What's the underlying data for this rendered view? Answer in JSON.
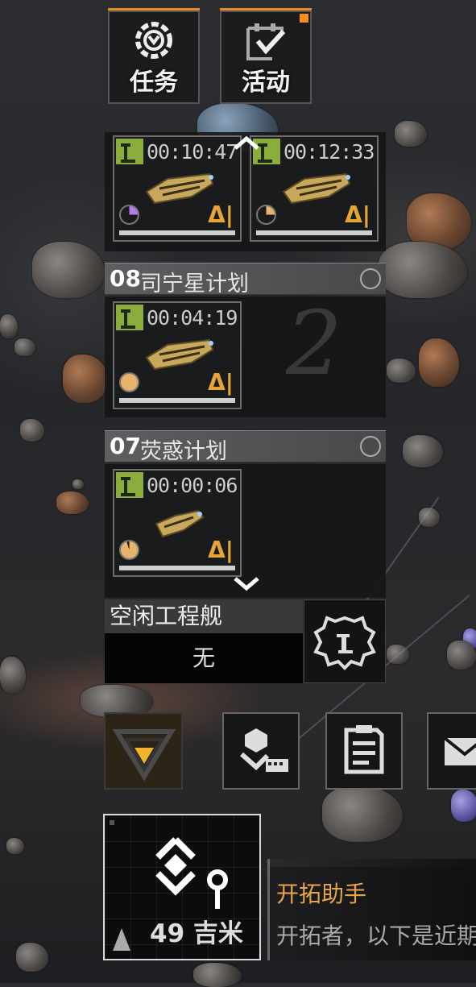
{
  "top_buttons": [
    {
      "label": "任务",
      "icon": "mission-gear-icon"
    },
    {
      "label": "活动",
      "icon": "activity-check-icon",
      "badge": true
    }
  ],
  "queue": {
    "cards": [
      {
        "time": "00:10:47",
        "progress_color": "#b57be8",
        "progress": 0.25
      },
      {
        "time": "00:12:33",
        "progress_color": "#e8b36a",
        "progress": 0.25
      }
    ]
  },
  "plans": [
    {
      "number": "08",
      "title": "司宁星计划",
      "watermark": "2",
      "cards": [
        {
          "time": "00:04:19",
          "progress": 1.0
        }
      ]
    },
    {
      "number": "07",
      "title": "荧惑计划",
      "cards": [
        {
          "time": "00:00:06",
          "progress": 0.95
        }
      ]
    }
  ],
  "idle_ships": {
    "label": "空闲工程舰",
    "value": "无"
  },
  "bottom_buttons": [
    "collapse-triangle-icon",
    "build-icon",
    "notes-icon",
    "mail-icon"
  ],
  "map": {
    "distance": "49 吉米"
  },
  "assistant": {
    "name": "开拓助手",
    "message": "开拓者，以下是近期"
  },
  "colors": {
    "accent_orange": "#e88a2a",
    "timer_green": "#8aad3e",
    "tier_gold": "#e8a534"
  }
}
